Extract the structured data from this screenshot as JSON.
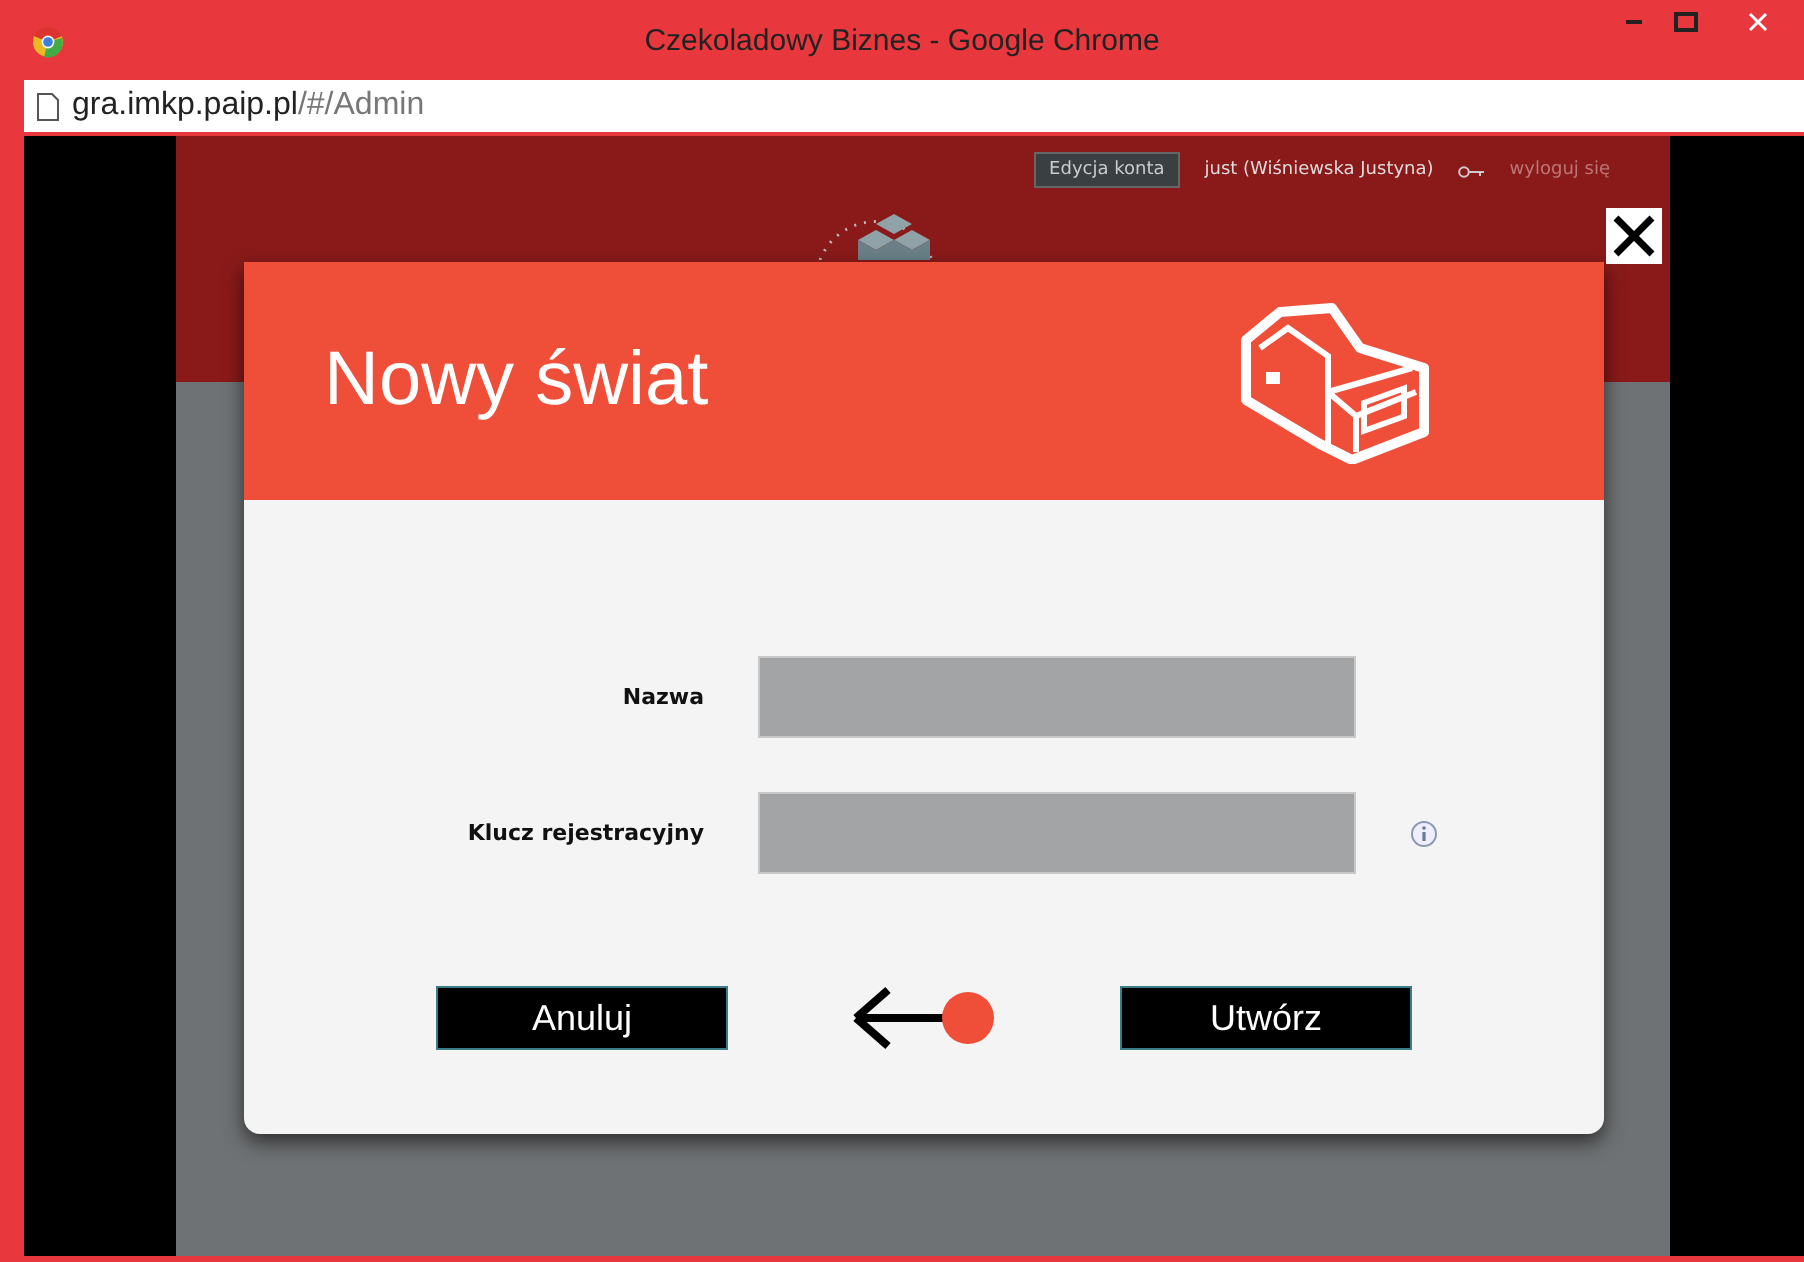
{
  "window": {
    "title": "Czekoladowy Biznes - Google Chrome"
  },
  "address_bar": {
    "host": "gra.imkp.paip.pl",
    "path": "/#/Admin"
  },
  "page_header": {
    "account_button": "Edycja konta",
    "user": "just (Wiśniewska Justyna)",
    "logout": "wyloguj się"
  },
  "dialog": {
    "title": "Nowy świat",
    "fields": [
      {
        "label": "Nazwa",
        "info": false
      },
      {
        "label": "Klucz rejestracyjny",
        "info": true
      }
    ],
    "buttons": [
      "Anuluj",
      "Utwórz"
    ]
  }
}
